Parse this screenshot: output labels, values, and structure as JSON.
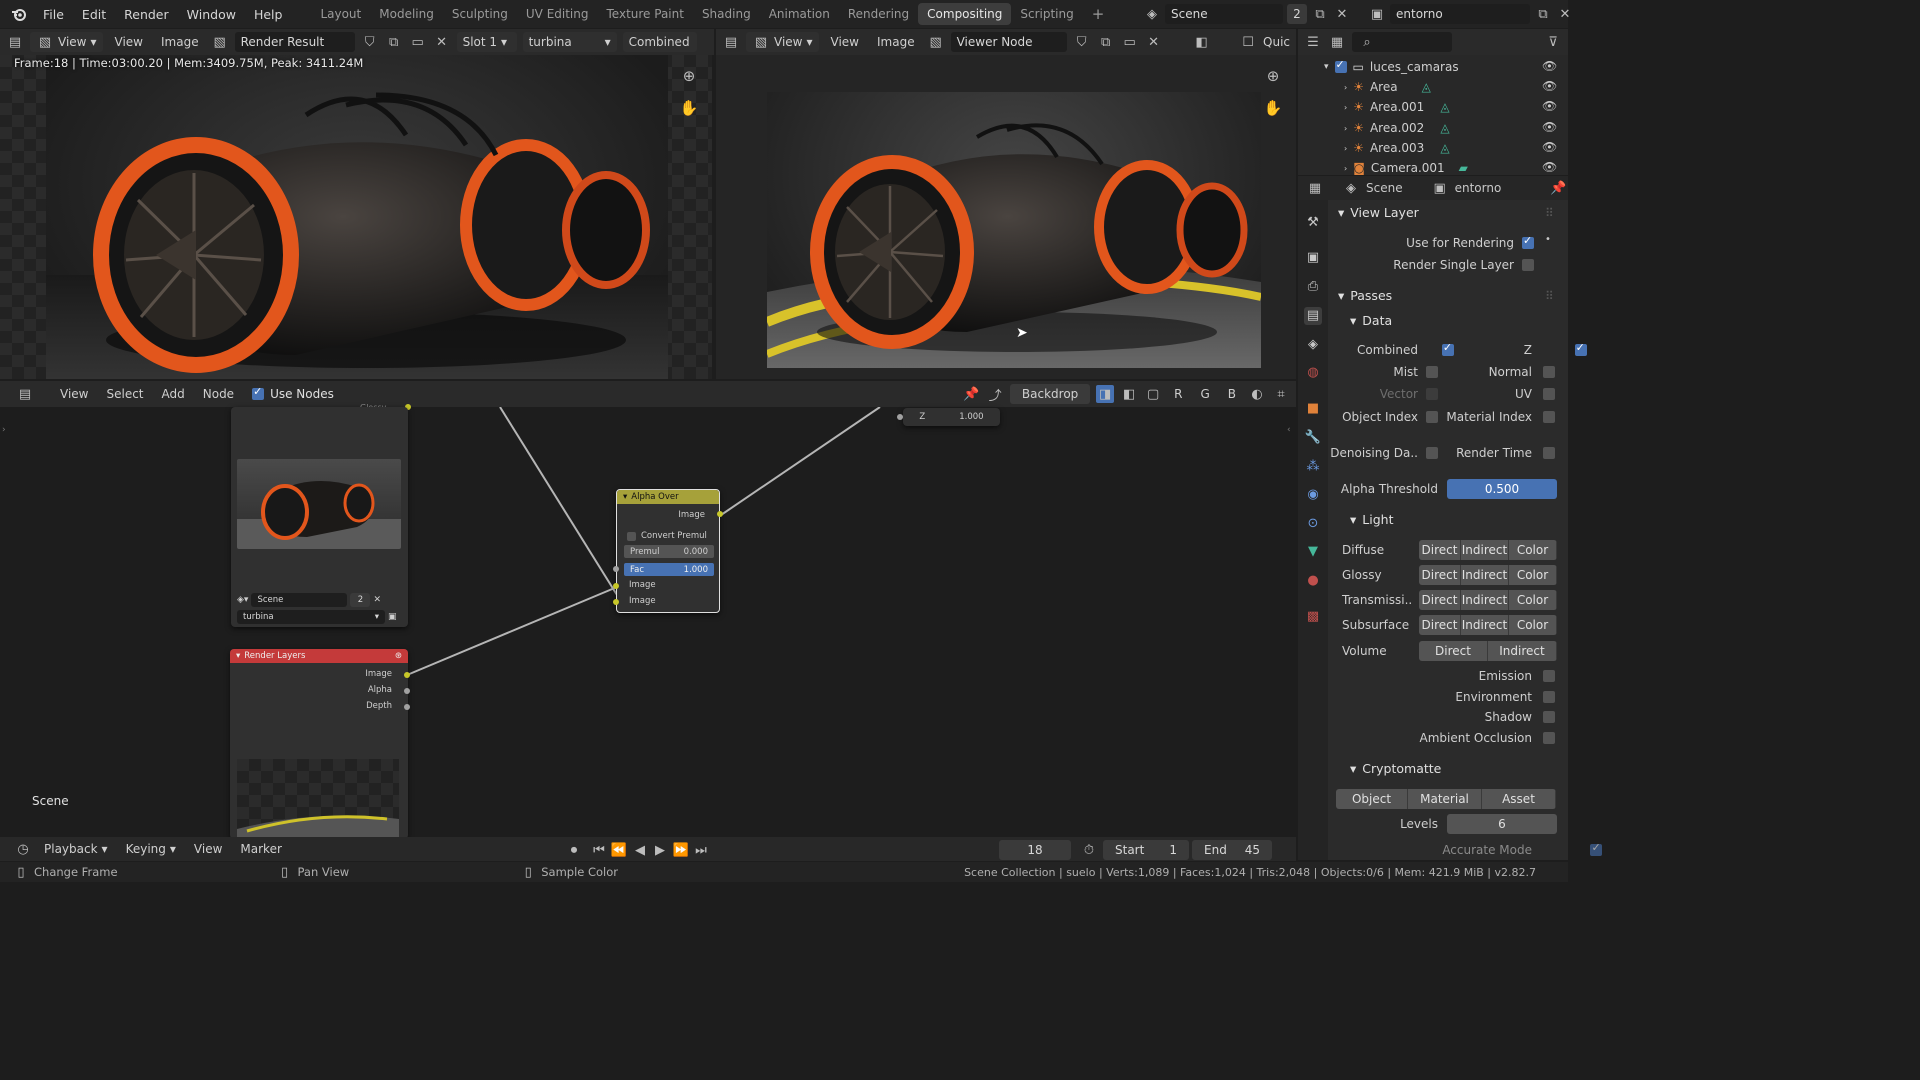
{
  "topbar": {
    "menus": [
      "File",
      "Edit",
      "Render",
      "Window",
      "Help"
    ],
    "workspaces": [
      "Layout",
      "Modeling",
      "Sculpting",
      "UV Editing",
      "Texture Paint",
      "Shading",
      "Animation",
      "Rendering",
      "Compositing",
      "Scripting"
    ],
    "active_workspace": "Compositing",
    "add_tab": "+",
    "scene_name": "Scene",
    "scene_users": "2",
    "view_layer": "entorno"
  },
  "left_image_editor": {
    "view_menu": "View",
    "menus": [
      "View",
      "Image"
    ],
    "image_name": "Render Result",
    "slot": "Slot 1",
    "layer": "turbina",
    "pass": "Combined",
    "frame_info": "Frame:18 | Time:03:00.20 | Mem:3409.75M, Peak: 3411.24M"
  },
  "right_image_editor": {
    "view_menu": "View",
    "menus": [
      "View",
      "Image"
    ],
    "image_name": "Viewer Node",
    "quick": "Quic"
  },
  "node_editor": {
    "menus": [
      "View",
      "Select",
      "Add",
      "Node"
    ],
    "use_nodes_label": "Use Nodes",
    "backdrop_label": "Backdrop",
    "channels": [
      "R",
      "G",
      "B"
    ],
    "scene_label": "Scene",
    "z_node": {
      "label": "Z",
      "value": "1.000"
    },
    "top_cut_label": "Glossy",
    "render_layers_top": {
      "scene": "Scene",
      "users": "2",
      "layer": "turbina"
    },
    "alpha_over": {
      "title": "Alpha Over",
      "output": "Image",
      "convert_premul": "Convert Premul",
      "premul_label": "Premul",
      "premul_value": "0.000",
      "fac_label": "Fac",
      "fac_value": "1.000",
      "input1": "Image",
      "input2": "Image"
    },
    "render_layers": {
      "title": "Render Layers",
      "outputs": [
        "Image",
        "Alpha",
        "Depth"
      ]
    }
  },
  "outliner": {
    "collection": "luces_camaras",
    "items": [
      "Area",
      "Area.001",
      "Area.002",
      "Area.003",
      "Camera.001"
    ]
  },
  "properties": {
    "scene_tab": "Scene",
    "layer_tab": "entorno",
    "view_layer": {
      "title": "View Layer",
      "use_for_rendering": "Use for Rendering",
      "render_single_layer": "Render Single Layer"
    },
    "passes": {
      "title": "Passes",
      "data_title": "Data",
      "combined": "Combined",
      "z": "Z",
      "mist": "Mist",
      "normal": "Normal",
      "vector": "Vector",
      "uv": "UV",
      "object_index": "Object Index",
      "material_index": "Material Index",
      "denoising": "Denoising Da..",
      "render_time": "Render Time",
      "alpha_threshold_label": "Alpha Threshold",
      "alpha_threshold_value": "0.500"
    },
    "light": {
      "title": "Light",
      "rows": [
        {
          "label": "Diffuse",
          "buttons": [
            "Direct",
            "Indirect",
            "Color"
          ]
        },
        {
          "label": "Glossy",
          "buttons": [
            "Direct",
            "Indirect",
            "Color"
          ]
        },
        {
          "label": "Transmissi..",
          "buttons": [
            "Direct",
            "Indirect",
            "Color"
          ]
        },
        {
          "label": "Subsurface",
          "buttons": [
            "Direct",
            "Indirect",
            "Color"
          ]
        },
        {
          "label": "Volume",
          "buttons": [
            "Direct",
            "Indirect"
          ]
        }
      ],
      "emission": "Emission",
      "environment": "Environment",
      "shadow": "Shadow",
      "ao": "Ambient Occlusion"
    },
    "cryptomatte": {
      "title": "Cryptomatte",
      "buttons": [
        "Object",
        "Material",
        "Asset"
      ],
      "levels_label": "Levels",
      "levels_value": "6",
      "accurate_mode": "Accurate Mode"
    }
  },
  "timeline": {
    "menus": [
      "Playback",
      "Keying",
      "View",
      "Marker"
    ],
    "current_frame": "18",
    "start_label": "Start",
    "start_value": "1",
    "end_label": "End",
    "end_value": "45"
  },
  "statusbar": {
    "hint1": "Change Frame",
    "hint2": "Pan View",
    "hint3": "Sample Color",
    "stats": "Scene Collection | suelo | Verts:1,089 | Faces:1,024 | Tris:2,048 | Objects:0/6 | Mem: 421.9 MiB | v2.82.7"
  },
  "colors": {
    "accent": "#4772b3",
    "render_layers_header": "#c43a3a",
    "alpha_over_header": "#a6a13a",
    "socket_yellow": "#c7c729",
    "socket_gray": "#a1a1a1",
    "active_tab": "#3d3d3d"
  }
}
